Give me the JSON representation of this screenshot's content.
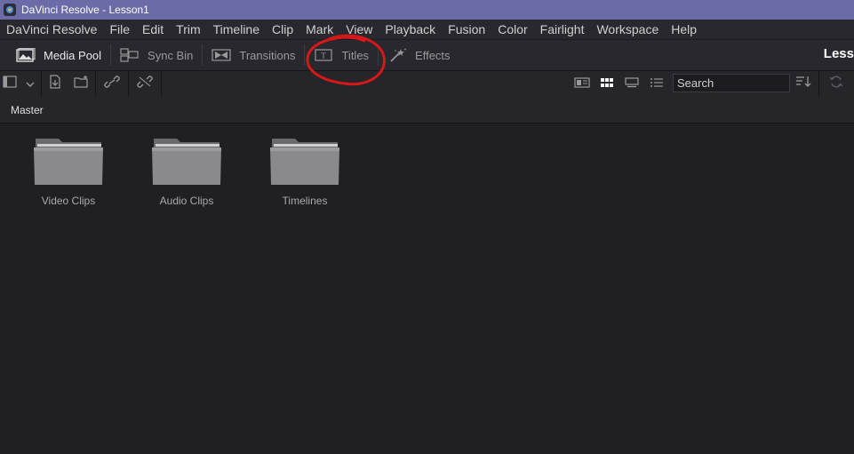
{
  "window": {
    "title": "DaVinci Resolve - Lesson1"
  },
  "menu": [
    "DaVinci Resolve",
    "File",
    "Edit",
    "Trim",
    "Timeline",
    "Clip",
    "Mark",
    "View",
    "Playback",
    "Fusion",
    "Color",
    "Fairlight",
    "Workspace",
    "Help"
  ],
  "panels": {
    "media_pool": "Media Pool",
    "sync_bin": "Sync Bin",
    "transitions": "Transitions",
    "titles": "Titles",
    "effects": "Effects"
  },
  "project_tag": "Less",
  "search": {
    "value": "Search"
  },
  "breadcrumb": "Master",
  "bins": [
    {
      "label": "Video Clips"
    },
    {
      "label": "Audio Clips"
    },
    {
      "label": "Timelines"
    }
  ],
  "colors": {
    "title_bar": "#6b6ba8",
    "annotation": "#d81818"
  }
}
